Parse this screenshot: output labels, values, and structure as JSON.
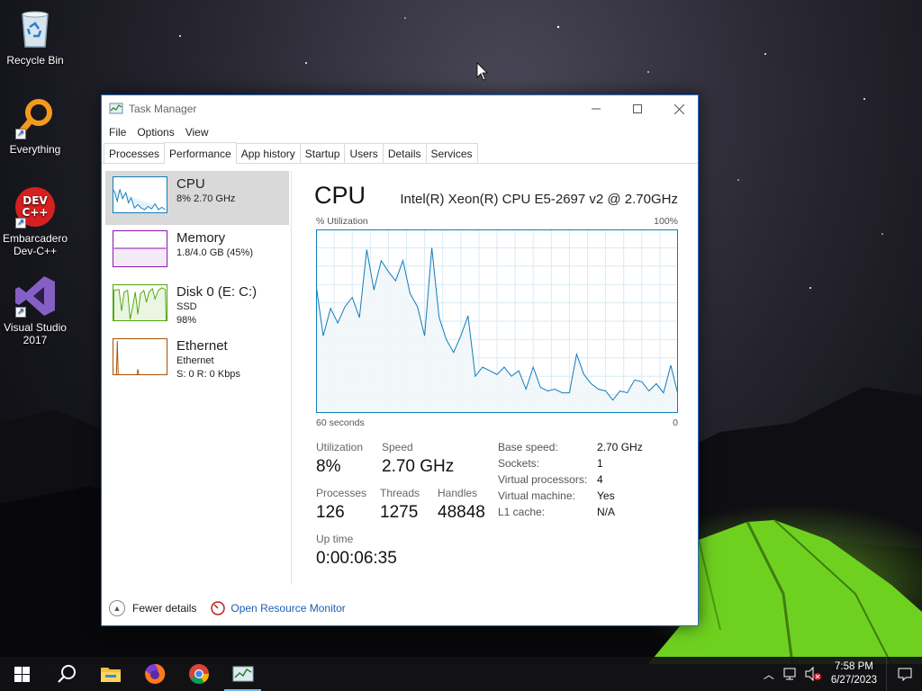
{
  "desktop": {
    "icons": [
      {
        "label": "Recycle Bin",
        "icon": "recycle-bin-icon"
      },
      {
        "label": "Everything",
        "icon": "everything-search-icon"
      },
      {
        "label": "Embarcadero Dev-C++",
        "icon": "devcpp-icon"
      },
      {
        "label": "Visual Studio 2017",
        "icon": "visual-studio-icon"
      }
    ]
  },
  "window": {
    "title": "Task Manager",
    "menu": [
      "File",
      "Options",
      "View"
    ],
    "tabs": [
      "Processes",
      "Performance",
      "App history",
      "Startup",
      "Users",
      "Details",
      "Services"
    ],
    "active_tab": "Performance"
  },
  "sidebar": {
    "items": [
      {
        "name": "CPU",
        "sub1": "8% 2.70 GHz",
        "sub2": "",
        "color": "#117dbb"
      },
      {
        "name": "Memory",
        "sub1": "1.8/4.0 GB (45%)",
        "sub2": "",
        "color": "#8b12ae"
      },
      {
        "name": "Disk 0 (E: C:)",
        "sub1": "SSD",
        "sub2": "98%",
        "color": "#4da60c"
      },
      {
        "name": "Ethernet",
        "sub1": "Ethernet",
        "sub2": "S: 0 R: 0 Kbps",
        "color": "#a74f01"
      }
    ]
  },
  "cpu": {
    "title": "CPU",
    "model": "Intel(R) Xeon(R) CPU E5-2697 v2 @ 2.70GHz",
    "graph": {
      "y_label": "% Utilization",
      "y_max_label": "100%",
      "x_left_label": "60 seconds",
      "x_right_label": "0",
      "values": [
        70,
        42,
        57,
        49,
        58,
        63,
        52,
        89,
        67,
        83,
        77,
        72,
        83,
        65,
        58,
        42,
        90,
        52,
        40,
        33,
        42,
        53,
        20,
        25,
        23,
        21,
        25,
        20,
        23,
        13,
        25,
        14,
        12,
        13,
        11,
        11,
        32,
        21,
        16,
        13,
        12,
        7,
        12,
        11,
        18,
        17,
        12,
        16,
        11,
        26,
        10
      ]
    },
    "stats": {
      "utilization_label": "Utilization",
      "utilization": "8%",
      "speed_label": "Speed",
      "speed": "2.70 GHz",
      "processes_label": "Processes",
      "processes": "126",
      "threads_label": "Threads",
      "threads": "1275",
      "handles_label": "Handles",
      "handles": "48848",
      "uptime_label": "Up time",
      "uptime": "0:00:06:35"
    },
    "details": [
      {
        "key": "Base speed:",
        "value": "2.70 GHz"
      },
      {
        "key": "Sockets:",
        "value": "1"
      },
      {
        "key": "Virtual processors:",
        "value": "4"
      },
      {
        "key": "Virtual machine:",
        "value": "Yes"
      },
      {
        "key": "L1 cache:",
        "value": "N/A"
      }
    ]
  },
  "footer": {
    "fewer_details": "Fewer details",
    "open_resource_monitor": "Open Resource Monitor"
  },
  "taskbar": {
    "time": "7:58 PM",
    "date": "6/27/2023"
  },
  "colors": {
    "cpu_line": "#117dbb",
    "cpu_fill": "#f1f6fa",
    "link": "#1a5fb4"
  }
}
